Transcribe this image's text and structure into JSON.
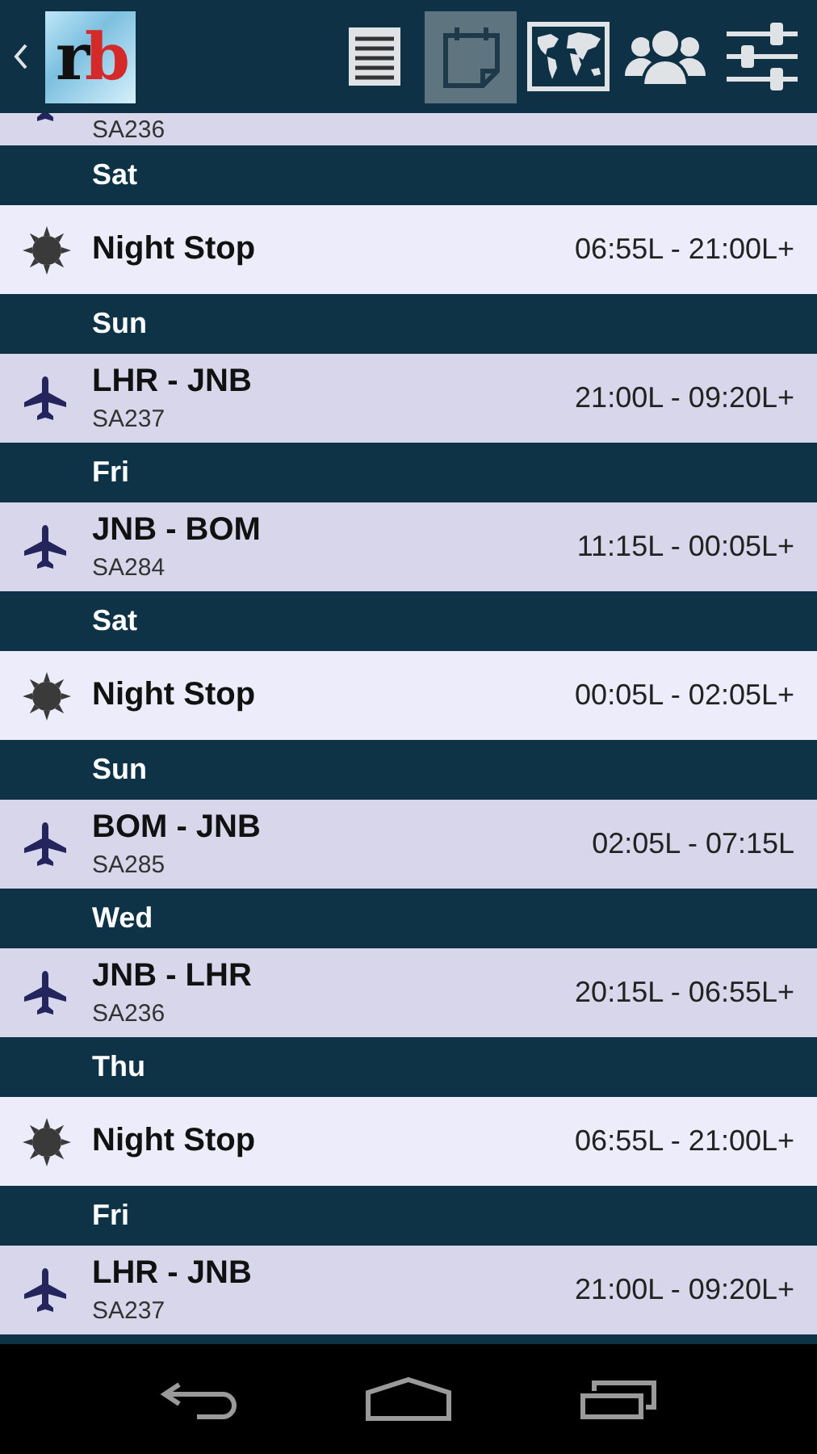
{
  "app_bar": {
    "logo": "rb",
    "tabs": [
      {
        "kind": "list",
        "selected": false
      },
      {
        "kind": "calendar",
        "selected": true
      },
      {
        "kind": "map",
        "selected": false
      },
      {
        "kind": "crew",
        "selected": false
      },
      {
        "kind": "settings",
        "selected": false
      }
    ]
  },
  "partial_entry": {
    "kind": "flight",
    "flight": "SA236"
  },
  "days": [
    {
      "day": "Sat",
      "entry": {
        "kind": "nightstop",
        "title": "Night Stop",
        "times": "06:55L - 21:00L+"
      }
    },
    {
      "day": "Sun",
      "entry": {
        "kind": "flight",
        "title": "LHR - JNB",
        "flight": "SA237",
        "times": "21:00L - 09:20L+"
      }
    },
    {
      "day": "Fri",
      "entry": {
        "kind": "flight",
        "title": "JNB - BOM",
        "flight": "SA284",
        "times": "11:15L - 00:05L+"
      }
    },
    {
      "day": "Sat",
      "entry": {
        "kind": "nightstop",
        "title": "Night Stop",
        "times": "00:05L - 02:05L+"
      }
    },
    {
      "day": "Sun",
      "entry": {
        "kind": "flight",
        "title": "BOM - JNB",
        "flight": "SA285",
        "times": "02:05L - 07:15L"
      }
    },
    {
      "day": "Wed",
      "entry": {
        "kind": "flight",
        "title": "JNB - LHR",
        "flight": "SA236",
        "times": "20:15L - 06:55L+"
      }
    },
    {
      "day": "Thu",
      "entry": {
        "kind": "nightstop",
        "title": "Night Stop",
        "times": "06:55L - 21:00L+"
      }
    },
    {
      "day": "Fri",
      "entry": {
        "kind": "flight",
        "title": "LHR - JNB",
        "flight": "SA237",
        "times": "21:00L - 09:20L+"
      }
    }
  ]
}
